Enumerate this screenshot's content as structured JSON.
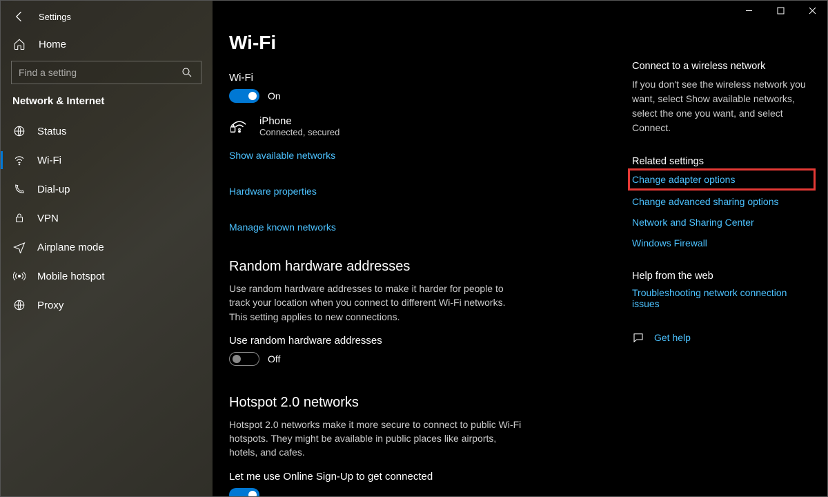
{
  "window": {
    "title": "Settings"
  },
  "sidebar": {
    "home": "Home",
    "search_placeholder": "Find a setting",
    "category": "Network & Internet",
    "items": [
      {
        "label": "Status"
      },
      {
        "label": "Wi-Fi"
      },
      {
        "label": "Dial-up"
      },
      {
        "label": "VPN"
      },
      {
        "label": "Airplane mode"
      },
      {
        "label": "Mobile hotspot"
      },
      {
        "label": "Proxy"
      }
    ]
  },
  "main": {
    "title": "Wi-Fi",
    "wifi": {
      "label": "Wi-Fi",
      "state": "On",
      "network_name": "iPhone",
      "network_status": "Connected, secured"
    },
    "links": {
      "show_networks": "Show available networks",
      "hw_props": "Hardware properties",
      "manage_known": "Manage known networks"
    },
    "random": {
      "heading": "Random hardware addresses",
      "desc": "Use random hardware addresses to make it harder for people to track your location when you connect to different Wi-Fi networks. This setting applies to new connections.",
      "label": "Use random hardware addresses",
      "state": "Off"
    },
    "hotspot": {
      "heading": "Hotspot 2.0 networks",
      "desc": "Hotspot 2.0 networks make it more secure to connect to public Wi-Fi hotspots. They might be available in public places like airports, hotels, and cafes.",
      "label": "Let me use Online Sign-Up to get connected"
    }
  },
  "aside": {
    "connect": {
      "heading": "Connect to a wireless network",
      "text": "If you don't see the wireless network you want, select Show available networks, select the one you want, and select Connect."
    },
    "related": {
      "heading": "Related settings",
      "links": [
        "Change adapter options",
        "Change advanced sharing options",
        "Network and Sharing Center",
        "Windows Firewall"
      ]
    },
    "help": {
      "heading": "Help from the web",
      "link": "Troubleshooting network connection issues",
      "get_help": "Get help"
    }
  }
}
